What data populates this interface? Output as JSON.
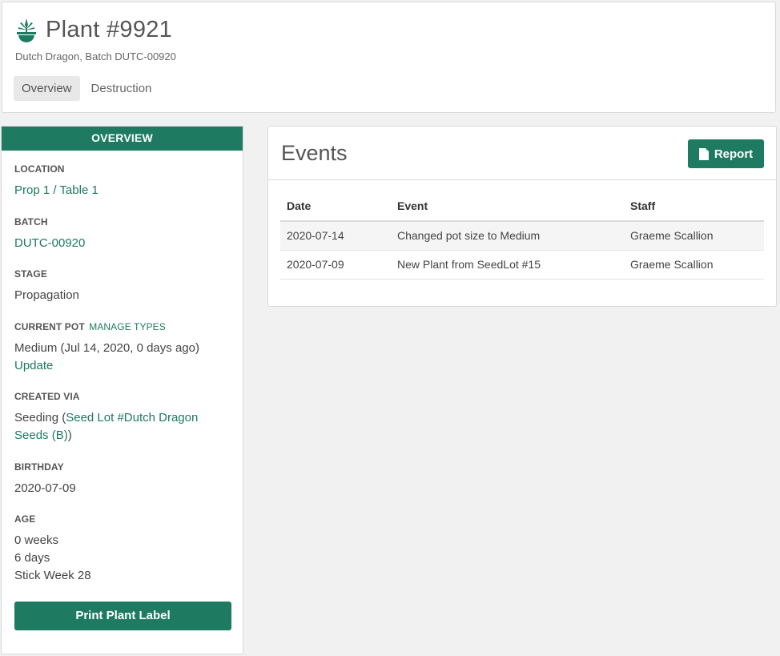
{
  "header": {
    "title": "Plant #9921",
    "subtitle": "Dutch Dragon, Batch DUTC-00920",
    "icon": "cannabis-leaf-in-pot-icon",
    "tabs": [
      {
        "label": "Overview",
        "active": true
      },
      {
        "label": "Destruction",
        "active": false
      }
    ]
  },
  "overview": {
    "heading": "OVERVIEW",
    "location": {
      "label": "LOCATION",
      "value": "Prop 1 / Table 1"
    },
    "batch": {
      "label": "BATCH",
      "value": "DUTC-00920"
    },
    "stage": {
      "label": "STAGE",
      "value": "Propagation"
    },
    "current_pot": {
      "label": "CURRENT POT",
      "manage_link": "MANAGE TYPES",
      "value": "Medium (Jul 14, 2020, 0 days ago)",
      "update_link": "Update"
    },
    "created_via": {
      "label": "CREATED VIA",
      "prefix": "Seeding (",
      "link": "Seed Lot #Dutch Dragon Seeds (B)",
      "suffix": ")"
    },
    "birthday": {
      "label": "BIRTHDAY",
      "value": "2020-07-09"
    },
    "age": {
      "label": "AGE",
      "weeks": "0 weeks",
      "days": "6 days",
      "stick_week": "Stick Week 28"
    },
    "print_button": "Print Plant Label"
  },
  "events": {
    "title": "Events",
    "report_button": "Report",
    "columns": [
      "Date",
      "Event",
      "Staff"
    ],
    "rows": [
      {
        "date": "2020-07-14",
        "event": "Changed pot size to Medium",
        "staff": "Graeme Scallion"
      },
      {
        "date": "2020-07-09",
        "event": "New Plant from SeedLot #15",
        "staff": "Graeme Scallion"
      }
    ]
  },
  "colors": {
    "brand_green": "#1e7b62",
    "link_green": "#1b7a5f"
  }
}
